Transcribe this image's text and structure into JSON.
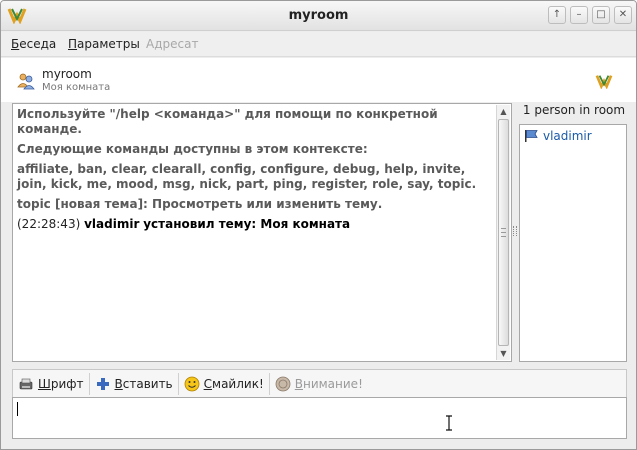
{
  "window": {
    "title": "myroom"
  },
  "menu": {
    "items": [
      {
        "label": "Беседа",
        "mnemonic": "Б",
        "rest": "еседа",
        "enabled": true
      },
      {
        "label": "Параметры",
        "mnemonic": "П",
        "rest": "араметры",
        "enabled": true
      },
      {
        "label": "Адресат",
        "mnemonic": "",
        "rest": "Адресат",
        "enabled": false
      }
    ]
  },
  "room": {
    "name": "myroom",
    "subject": "Моя комната"
  },
  "chat": {
    "help_hint": "Используйте \"/help <команда>\" для помощи по конкретной команде.",
    "commands_intro": "Следующие команды доступны в этом контексте:",
    "commands_list": "affiliate, ban, clear, clearall, config, configure, debug, help, invite, join, kick, me, mood, msg, nick, part, ping, register, role, say, topic.",
    "topic_help": "topic [новая тема]:  Просмотреть или изменить тему.",
    "event": {
      "timestamp": "(22:28:43)",
      "nick": "vladimir",
      "text": "установил тему: Моя комната"
    }
  },
  "occupants": {
    "count_label": "1 person in room",
    "list": [
      "vladimir"
    ]
  },
  "toolbar": {
    "font": {
      "u": "Ш",
      "rest": "рифт"
    },
    "insert": {
      "u": "В",
      "rest": "ставить"
    },
    "smiley": {
      "u": "С",
      "rest": "майлик!"
    },
    "attention": {
      "u": "В",
      "rest": "нимание!"
    }
  },
  "colors": {
    "nick_link": "#1a5aa8",
    "system_text": "#5a5a5a"
  },
  "icons": [
    "app-logo-icon",
    "minimize-icon",
    "maximize-icon",
    "close-icon",
    "room-people-icon",
    "flag-icon",
    "font-icon",
    "insert-plus-icon",
    "smiley-icon",
    "attention-icon",
    "text-cursor-icon"
  ]
}
